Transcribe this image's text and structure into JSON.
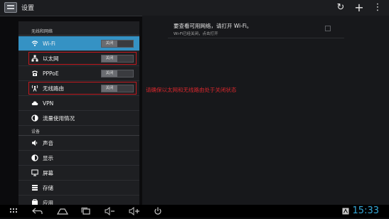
{
  "app": {
    "title": "设置"
  },
  "actionbar": {
    "icons": [
      "sync-icon",
      "add-icon",
      "overflow-menu-icon"
    ],
    "sync_glyph": "↻",
    "add_glyph": "+",
    "overflow_glyph": "⋮"
  },
  "sidebar": {
    "sections": [
      {
        "header": "无线和网络",
        "items": [
          {
            "label": "Wi-Fi",
            "icon": "wifi-icon",
            "toggle": "关闭",
            "selected": true
          },
          {
            "label": "以太网",
            "icon": "ethernet-icon",
            "toggle": "关闭"
          },
          {
            "label": "PPPoE",
            "icon": "phone-icon",
            "toggle": "关闭"
          },
          {
            "label": "无线路由",
            "icon": "hotspot-icon",
            "toggle": "关闭"
          },
          {
            "label": "VPN",
            "icon": "cloud-icon"
          },
          {
            "label": "流量使用情况",
            "icon": "data-usage-icon"
          }
        ]
      },
      {
        "header": "设备",
        "items": [
          {
            "label": "声音",
            "icon": "speaker-icon"
          },
          {
            "label": "显示",
            "icon": "brightness-icon"
          },
          {
            "label": "屏幕",
            "icon": "monitor-icon"
          },
          {
            "label": "存储",
            "icon": "storage-icon"
          },
          {
            "label": "应用",
            "icon": "apps-icon"
          }
        ]
      }
    ]
  },
  "main": {
    "wifi_hint_title": "要查看可用网络，请打开 Wi-Fi。",
    "wifi_hint_subtitle": "Wi-Fi已经关闭，点击打开",
    "annotation": "请确保以太网和无线路由处于关闭状态",
    "annotation_color": "#d8272d"
  },
  "navbar": {
    "clock": "15:33",
    "buttons": [
      "menu-grid-icon",
      "back-icon",
      "home-icon",
      "recent-apps-icon",
      "volume-down-icon",
      "volume-up-icon",
      "power-icon"
    ],
    "clock_color": "#35a8d8"
  },
  "colors": {
    "selected_item": "#3592c4",
    "highlight_box": "#c0191f"
  }
}
